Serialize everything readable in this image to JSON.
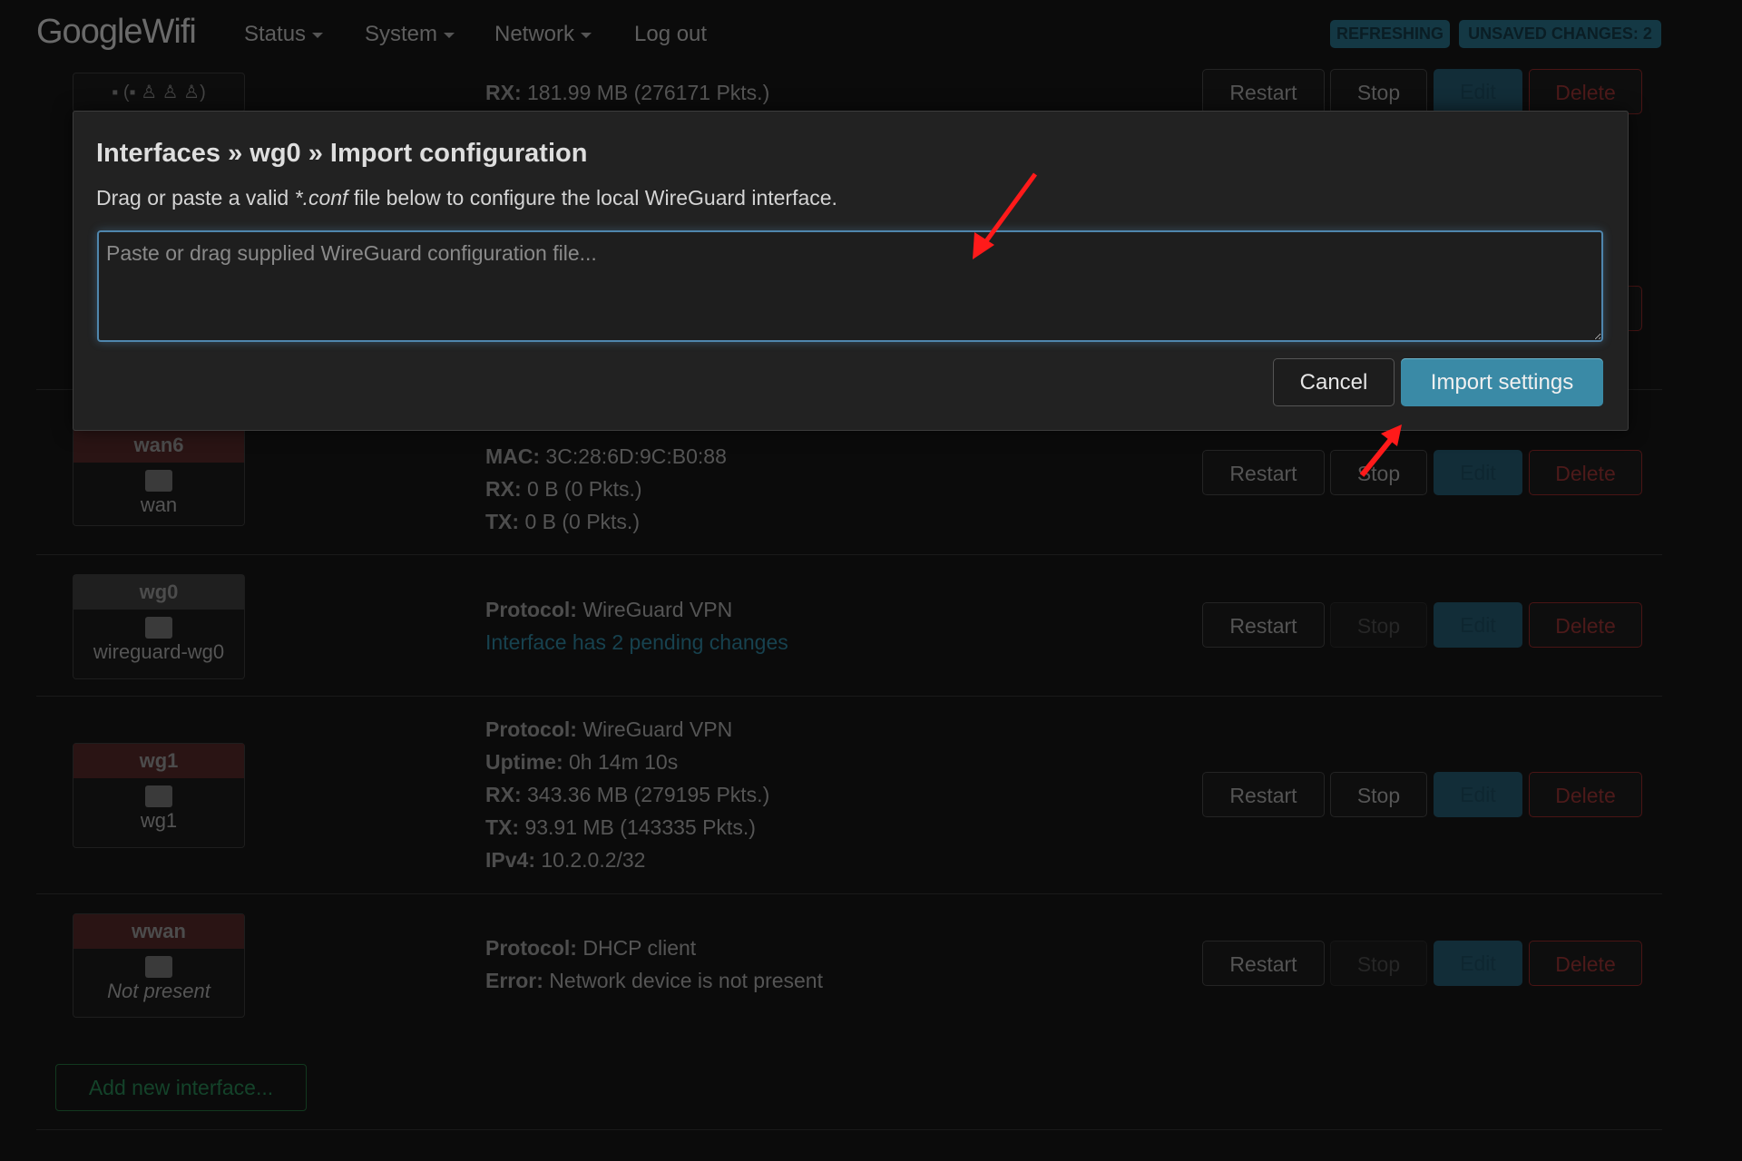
{
  "navbar": {
    "brand": "GoogleWifi",
    "menu": [
      {
        "label": "Status",
        "dropdown": true
      },
      {
        "label": "System",
        "dropdown": true
      },
      {
        "label": "Network",
        "dropdown": true
      },
      {
        "label": "Log out",
        "dropdown": false
      }
    ],
    "badges": [
      "REFRESHING",
      "UNSAVED CHANGES: 2"
    ]
  },
  "buttons": {
    "restart": "Restart",
    "stop": "Stop",
    "edit": "Edit",
    "delete": "Delete"
  },
  "interfaces": [
    {
      "name": "",
      "device": "",
      "lines": [
        {
          "k": "RX:",
          "v": " 181.99 MB (276171 Pkts.)"
        }
      ],
      "stop_disabled": false
    },
    {
      "name": "wan6",
      "device": "wan",
      "lines": [
        {
          "k": "MAC:",
          "v": " 3C:28:6D:9C:B0:88"
        },
        {
          "k": "RX:",
          "v": " 0 B (0 Pkts.)"
        },
        {
          "k": "TX:",
          "v": " 0 B (0 Pkts.)"
        }
      ],
      "stop_disabled": false
    },
    {
      "name": "wg0",
      "device": "wireguard-wg0",
      "lines": [
        {
          "k": "Protocol:",
          "v": " WireGuard VPN"
        }
      ],
      "pending": "Interface has 2 pending changes",
      "stop_disabled": true
    },
    {
      "name": "wg1",
      "device": "wg1",
      "lines": [
        {
          "k": "Protocol:",
          "v": " WireGuard VPN"
        },
        {
          "k": "Uptime:",
          "v": " 0h 14m 10s"
        },
        {
          "k": "RX:",
          "v": " 343.36 MB (279195 Pkts.)"
        },
        {
          "k": "TX:",
          "v": " 93.91 MB (143335 Pkts.)"
        },
        {
          "k": "IPv4:",
          "v": " 10.2.0.2/32"
        }
      ],
      "stop_disabled": false
    },
    {
      "name": "wwan",
      "device": "Not present",
      "lines": [
        {
          "k": "Protocol:",
          "v": " DHCP client"
        },
        {
          "k": "Error:",
          "v": " Network device is not present"
        }
      ],
      "stop_disabled": true
    }
  ],
  "add_interface": "Add new interface...",
  "modal": {
    "title": "Interfaces » wg0 » Import configuration",
    "desc_before": "Drag or paste a valid ",
    "desc_em": "*.conf",
    "desc_after": " file below to configure the local WireGuard interface.",
    "placeholder": "Paste or drag supplied WireGuard configuration file...",
    "value": "",
    "cancel": "Cancel",
    "import": "Import settings"
  },
  "annotation_color": "#ff1a1a"
}
